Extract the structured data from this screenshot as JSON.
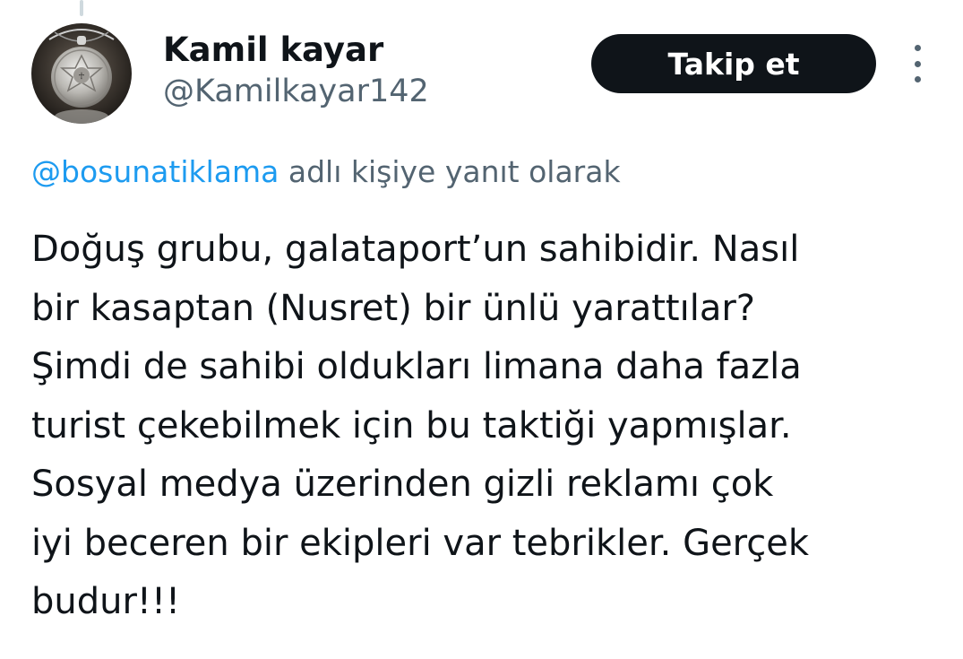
{
  "tweet": {
    "author": {
      "display_name": "Kamil kayar",
      "handle": "@Kamilkayar142",
      "avatar_icon": "silver-pendant-avatar"
    },
    "follow_label": "Takip et",
    "more_icon": "vertical-ellipsis-icon",
    "reply_context": {
      "mention": "@bosunatiklama",
      "suffix": "adlı kişiye yanıt olarak"
    },
    "text_lines": [
      "Doğuş grubu, galataport’un sahibidir. Nasıl",
      "bir kasaptan (Nusret) bir ünlü yarattılar?",
      "Şimdi de sahibi oldukları limana daha fazla",
      "turist çekebilmek için bu taktiği yapmışlar.",
      "Sosyal medya üzerinden gizli reklamı çok",
      "iyi beceren bir ekipleri var tebrikler. Gerçek",
      "budur!!!"
    ]
  },
  "colors": {
    "text_primary": "#0f1419",
    "text_secondary": "#536471",
    "link": "#1d9bf0",
    "button_bg": "#0f1419",
    "button_text": "#ffffff"
  }
}
